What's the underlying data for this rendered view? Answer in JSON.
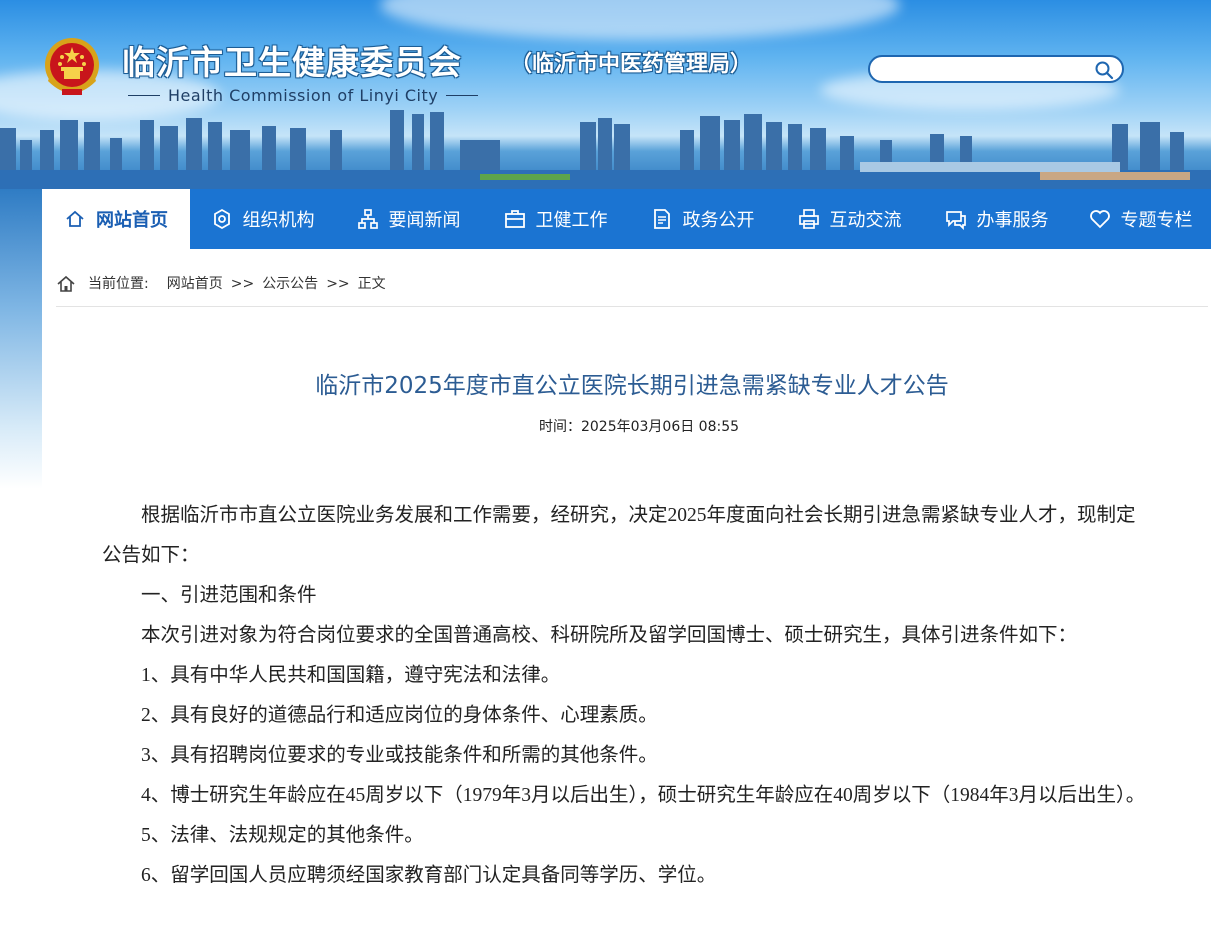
{
  "header": {
    "title": "临沂市卫生健康委员会",
    "subtitle": "（临沂市中医药管理局）",
    "english": "Health Commission of Linyi City",
    "emblem_icon": "national-emblem-icon"
  },
  "search": {
    "placeholder": "",
    "value": "",
    "icon": "search-icon"
  },
  "nav": {
    "items": [
      {
        "label": "网站首页",
        "icon": "home-icon",
        "active": true
      },
      {
        "label": "组织机构",
        "icon": "settings-icon",
        "active": false
      },
      {
        "label": "要闻新闻",
        "icon": "sitemap-icon",
        "active": false
      },
      {
        "label": "卫健工作",
        "icon": "toolbox-icon",
        "active": false
      },
      {
        "label": "政务公开",
        "icon": "document-icon",
        "active": false
      },
      {
        "label": "互动交流",
        "icon": "print-icon",
        "active": false
      },
      {
        "label": "办事服务",
        "icon": "service-icon",
        "active": false
      },
      {
        "label": "专题专栏",
        "icon": "heart-icon",
        "active": false
      }
    ]
  },
  "breadcrumb": {
    "label": "当前位置:",
    "items": [
      "网站首页",
      "公示公告",
      "正文"
    ],
    "separator": ">>"
  },
  "article": {
    "title": "临沂市2025年度市直公立医院长期引进急需紧缺专业人才公告",
    "time": "时间：2025年03月06日 08:55",
    "paragraphs": [
      "根据临沂市市直公立医院业务发展和工作需要，经研究，决定2025年度面向社会长期引进急需紧缺专业人才，现制定公告如下：",
      "一、引进范围和条件",
      "本次引进对象为符合岗位要求的全国普通高校、科研院所及留学回国博士、硕士研究生，具体引进条件如下：",
      "1、具有中华人民共和国国籍，遵守宪法和法律。",
      "2、具有良好的道德品行和适应岗位的身体条件、心理素质。",
      "3、具有招聘岗位要求的专业或技能条件和所需的其他条件。",
      "4、博士研究生年龄应在45周岁以下（1979年3月以后出生），硕士研究生年龄应在40周岁以下（1984年3月以后出生）。",
      "5、法律、法规规定的其他条件。",
      "6、留学回国人员应聘须经国家教育部门认定具备同等学历、学位。"
    ]
  },
  "colors": {
    "nav_bg": "#1b74d2",
    "nav_active_text": "#1b5fb3",
    "title_color": "#2c5c93"
  }
}
